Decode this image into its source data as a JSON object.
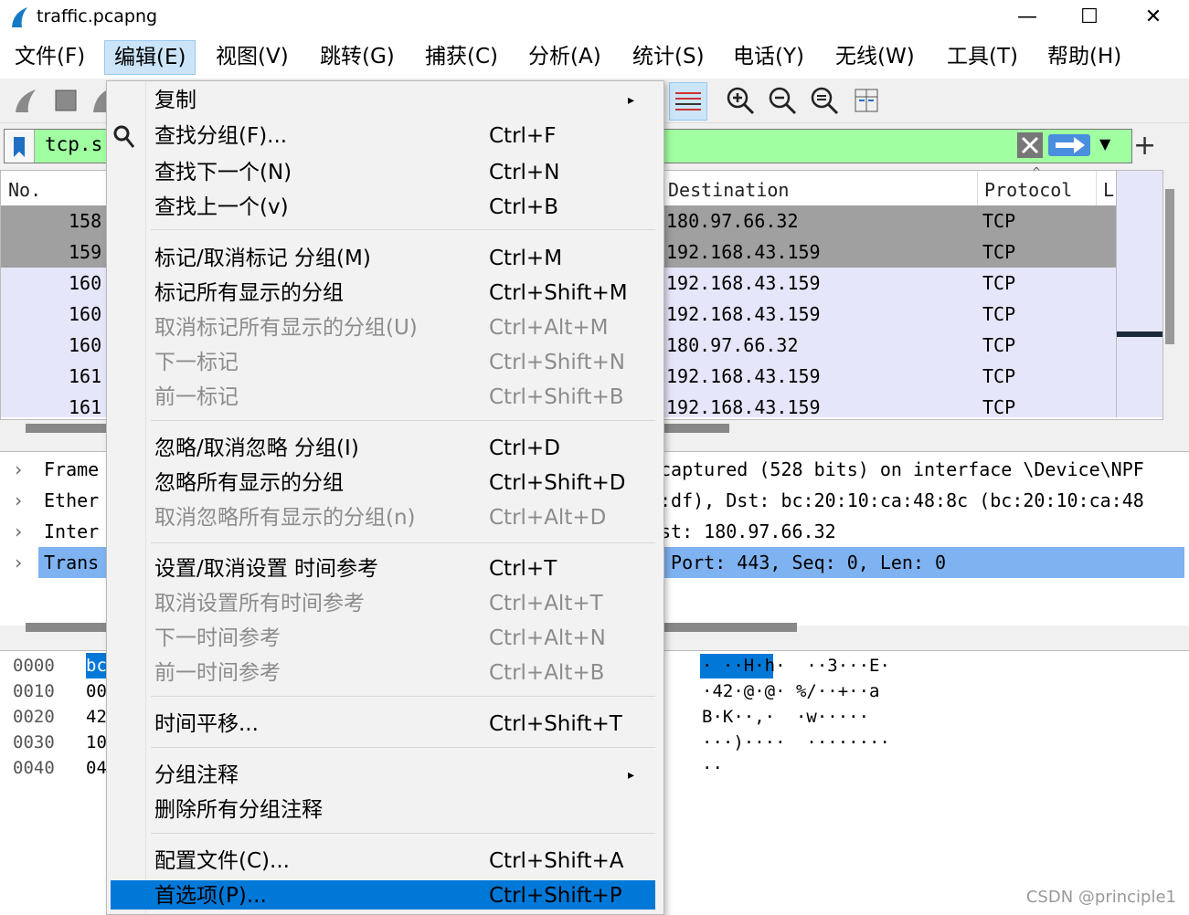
{
  "window": {
    "title": "traffic.pcapng",
    "min": "—",
    "max": "☐",
    "close": "✕"
  },
  "menubar": [
    "文件(F)",
    "编辑(E)",
    "视图(V)",
    "跳转(G)",
    "捕获(C)",
    "分析(A)",
    "统计(S)",
    "电话(Y)",
    "无线(W)",
    "工具(T)",
    "帮助(H)"
  ],
  "filter": {
    "text": "tcp.s"
  },
  "packet_list": {
    "headers": {
      "no": "No.",
      "destination": "Destination",
      "protocol": "Protocol",
      "length": "L"
    },
    "rows": [
      {
        "no": "158",
        "dst": "180.97.66.32",
        "proto": "TCP"
      },
      {
        "no": "159",
        "dst": "192.168.43.159",
        "proto": "TCP"
      },
      {
        "no": "160",
        "dst": "192.168.43.159",
        "proto": "TCP"
      },
      {
        "no": "160",
        "dst": "192.168.43.159",
        "proto": "TCP"
      },
      {
        "no": "160",
        "dst": "180.97.66.32",
        "proto": "TCP"
      },
      {
        "no": "161",
        "dst": "192.168.43.159",
        "proto": "TCP"
      },
      {
        "no": "161",
        "dst": "192.168.43.159",
        "proto": "TCP"
      }
    ]
  },
  "details": [
    {
      "left": "Frame",
      "right": "captured (528 bits) on interface \\Device\\NPF"
    },
    {
      "left": "Ether",
      "right": ":df), Dst: bc:20:10:ca:48:8c (bc:20:10:ca:48"
    },
    {
      "left": "Inter",
      "right": "st: 180.97.66.32"
    },
    {
      "left": "Trans",
      "right": " Port: 443, Seq: 0, Len: 0"
    }
  ],
  "bytes": {
    "offsets": [
      "0000",
      "0010",
      "0020",
      "0030",
      "0040"
    ],
    "hex_first": [
      "bc",
      "00",
      "42",
      "10",
      "04"
    ],
    "ascii": [
      "· ··H·h·  ··3···E·",
      "·42·@·@· %/··+··a",
      "B·K··,·  ·w·····",
      "···)····  ········",
      "··"
    ]
  },
  "dropdown": {
    "items": [
      {
        "label": "复制",
        "shortcut": "",
        "submenu": true
      },
      {
        "label": "查找分组(F)...",
        "shortcut": "Ctrl+F"
      },
      {
        "label": "查找下一个(N)",
        "shortcut": "Ctrl+N"
      },
      {
        "label": "查找上一个(v)",
        "shortcut": "Ctrl+B"
      },
      {
        "label": "标记/取消标记 分组(M)",
        "shortcut": "Ctrl+M"
      },
      {
        "label": "标记所有显示的分组",
        "shortcut": "Ctrl+Shift+M"
      },
      {
        "label": "取消标记所有显示的分组(U)",
        "shortcut": "Ctrl+Alt+M",
        "disabled": true
      },
      {
        "label": "下一标记",
        "shortcut": "Ctrl+Shift+N",
        "disabled": true
      },
      {
        "label": "前一标记",
        "shortcut": "Ctrl+Shift+B",
        "disabled": true
      },
      {
        "label": "忽略/取消忽略 分组(I)",
        "shortcut": "Ctrl+D"
      },
      {
        "label": "忽略所有显示的分组",
        "shortcut": "Ctrl+Shift+D"
      },
      {
        "label": "取消忽略所有显示的分组(n)",
        "shortcut": "Ctrl+Alt+D",
        "disabled": true
      },
      {
        "label": "设置/取消设置 时间参考",
        "shortcut": "Ctrl+T"
      },
      {
        "label": "取消设置所有时间参考",
        "shortcut": "Ctrl+Alt+T",
        "disabled": true
      },
      {
        "label": "下一时间参考",
        "shortcut": "Ctrl+Alt+N",
        "disabled": true
      },
      {
        "label": "前一时间参考",
        "shortcut": "Ctrl+Alt+B",
        "disabled": true
      },
      {
        "label": "时间平移...",
        "shortcut": "Ctrl+Shift+T"
      },
      {
        "label": "分组注释",
        "shortcut": "",
        "submenu": true
      },
      {
        "label": "删除所有分组注释",
        "shortcut": ""
      },
      {
        "label": "配置文件(C)...",
        "shortcut": "Ctrl+Shift+A"
      },
      {
        "label": "首选项(P)...",
        "shortcut": "Ctrl+Shift+P",
        "selected": true
      }
    ]
  },
  "watermark": "CSDN @principle1",
  "colors": {
    "selected": "#0078d7",
    "filter_ok": "#a0ffa0",
    "row_marked": "#a0a0a0",
    "row_normal": "#e6e6fa",
    "detail_selected": "#7fb2f0"
  }
}
